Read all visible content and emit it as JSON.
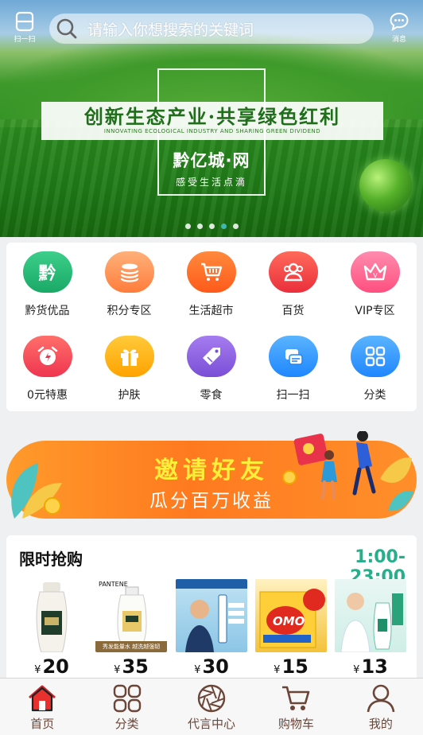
{
  "top_bar": {
    "scan_label": "扫一扫",
    "search_placeholder": "请输入你想搜索的关键词",
    "message_label": "消息"
  },
  "banner": {
    "slogan": "创新生态产业·共享绿色红利",
    "slogan_en": "INNOVATING ECOLOGICAL INDUSTRY AND SHARING GREEN DIVIDEND",
    "brand": "黔亿城·网",
    "tagline": "感受生活点滴",
    "slide_count": 5,
    "active_slide": 4
  },
  "categories": [
    {
      "label": "黔货优品",
      "icon": "qian-badge-icon",
      "glyph": "黔",
      "color": "#22b573"
    },
    {
      "label": "积分专区",
      "icon": "coin-stack-icon",
      "glyph": "",
      "color": "#ff8c4a"
    },
    {
      "label": "生活超市",
      "icon": "shopping-cart-icon",
      "glyph": "",
      "color": "#ff6a2a"
    },
    {
      "label": "百货",
      "icon": "users-icon",
      "glyph": "",
      "color": "#f2474c"
    },
    {
      "label": "VIP专区",
      "icon": "crown-icon",
      "glyph": "",
      "color": "#ff5f8a"
    },
    {
      "label": "0元特惠",
      "icon": "alarm-clock-icon",
      "glyph": "",
      "color": "#f5475a"
    },
    {
      "label": "护肤",
      "icon": "gift-icon",
      "glyph": "",
      "color": "#ffb21a"
    },
    {
      "label": "零食",
      "icon": "tag-icon",
      "glyph": "",
      "color": "#8a5cd9"
    },
    {
      "label": "扫一扫",
      "icon": "scan-card-icon",
      "glyph": "",
      "color": "#2f9bff"
    },
    {
      "label": "分类",
      "icon": "grid-icon",
      "glyph": "",
      "color": "#2f9bff"
    }
  ],
  "invite": {
    "title": "邀请好友",
    "subtitle": "瓜分百万收益"
  },
  "flash_sale": {
    "title": "限时抢购",
    "time_range": "1:00-23:00",
    "currency": "¥",
    "products": [
      {
        "price": "20",
        "image": "shampoo-bottle-image",
        "bg": "#ffffff"
      },
      {
        "price": "35",
        "image": "pantene-bottle-image",
        "bg": "#ffffff",
        "brand_text": "PANTENE",
        "promo_text": "秀发能量水 越洗越强韧"
      },
      {
        "price": "30",
        "image": "toothpaste-ad-image",
        "bg": "#9ed0ea"
      },
      {
        "price": "15",
        "image": "omo-box-image",
        "bg": "#f4c23a",
        "brand_text": "OMO"
      },
      {
        "price": "13",
        "image": "shampoo-ad-image",
        "bg": "#dff3ef"
      }
    ]
  },
  "bottom_nav": [
    {
      "label": "首页",
      "icon": "home-icon",
      "active": true
    },
    {
      "label": "分类",
      "icon": "grid-icon",
      "active": false
    },
    {
      "label": "代言中心",
      "icon": "aperture-icon",
      "active": false
    },
    {
      "label": "购物车",
      "icon": "cart-icon",
      "active": false
    },
    {
      "label": "我的",
      "icon": "user-icon",
      "active": false
    }
  ]
}
